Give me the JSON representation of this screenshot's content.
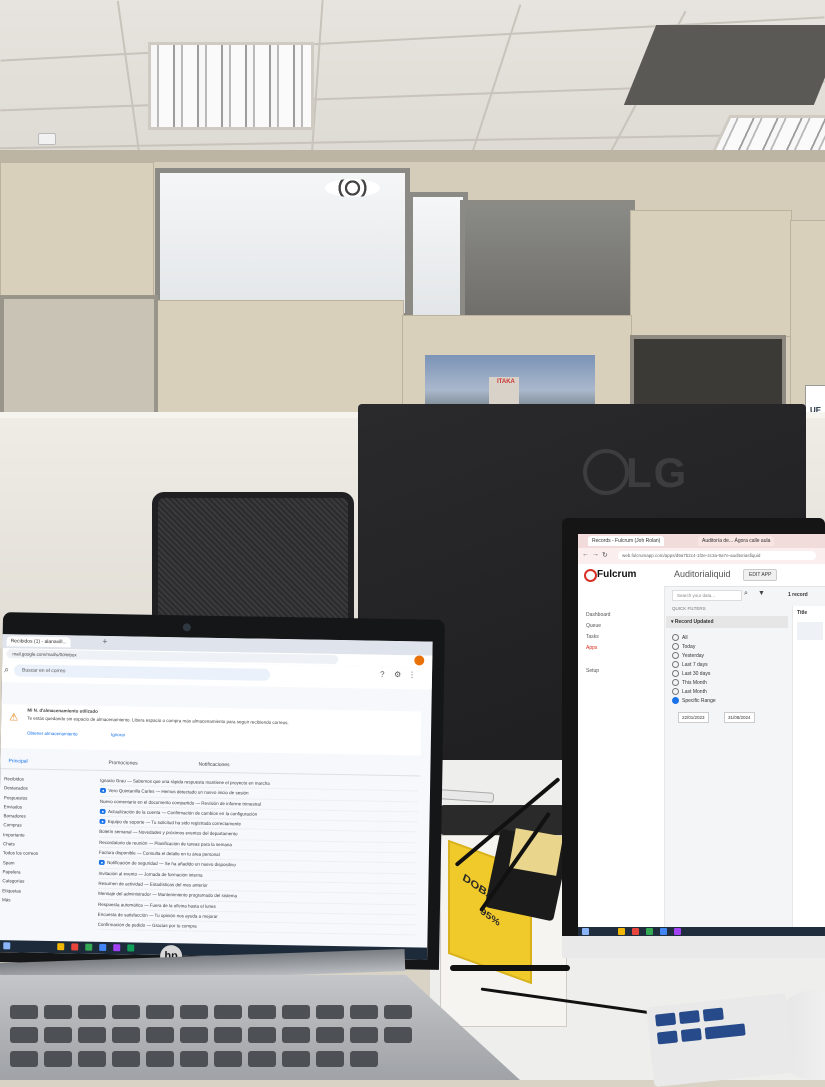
{
  "scene": {
    "monitor_brand": "LG",
    "laptop_brand": "hp",
    "box_label": "DOBAL",
    "box_sub": "95%",
    "poster_text": "ITAKA",
    "cut_off_sign": "UE"
  },
  "laptop": {
    "browser_tab": "Recibidos (1) - alanavill...",
    "url": "mail.google.com/mail/u/0/#inbox",
    "search_placeholder": "Buscar en el correo",
    "warning_title": "Mi N. d'almacenamiento utilizado",
    "warning_body": "Te estás quedando sin espacio de almacenamiento. Libera espacio o compra más almacenamiento para seguir recibiendo correos.",
    "warning_link_1": "Obtener almacenamiento",
    "warning_link_2": "Ignorar",
    "category_tabs": [
      "Principal",
      "Promociones",
      "Notificaciones"
    ],
    "sidebar": [
      "Recibidos",
      "Destacados",
      "Pospuestos",
      "Enviados",
      "Borradores",
      "Compras",
      "Importante",
      "Chats",
      "Todos los correos",
      "Spam",
      "Papelera",
      "Categorías",
      "Etiquetas",
      "Más"
    ],
    "emails": [
      "Ignacio Grau — Sabemos que una rápida respuesta mantiene el proyecto en marcha",
      "Vero Quintanilla Carles — Hemos detectado un nuevo inicio de sesión",
      "Nuevo comentario en el documento compartido — Revisión de informe trimestral",
      "Actualización de la cuenta — Confirmación de cambios en la configuración",
      "Equipo de soporte — Tu solicitud ha sido registrada correctamente",
      "Boletín semanal — Novedades y próximos eventos del departamento",
      "Recordatorio de reunión — Planificación de tareas para la semana",
      "Factura disponible — Consulta el detalle en tu área personal",
      "Notificación de seguridad — Se ha añadido un nuevo dispositivo",
      "Invitación al evento — Jornada de formación interna",
      "Resumen de actividad — Estadísticas del mes anterior",
      "Mensaje del administrador — Mantenimiento programado del sistema",
      "Respuesta automática — Fuera de la oficina hasta el lunes",
      "Encuesta de satisfacción — Tu opinión nos ayuda a mejorar",
      "Confirmación de pedido — Gracias por tu compra"
    ]
  },
  "monitor": {
    "browser_tab_1": "Records - Fulcrum (Joh Rolan)",
    "browser_tab_2": "Auditoría de... Ágora calle aula",
    "url": "web.fulcrumapp.com/apps/d9a7b2c4-1f2e-4c3a-9a7e-auditoriasfiquid",
    "brand": "Fulcrum",
    "app_name": "Auditorialiquid",
    "edit_button": "EDIT APP",
    "search_placeholder": "Search your data...",
    "record_count": "1 record",
    "sidebar": [
      "Dashboard",
      "Queue",
      "Tasks",
      "Apps"
    ],
    "sidebar_secondary": "Setup",
    "quick_filters": "QUICK FILTERS",
    "filter_header": "Record Updated",
    "filter_options": [
      "All",
      "Today",
      "Yesterday",
      "Last 7 days",
      "Last 30 days",
      "This Month",
      "Last Month",
      "Specific Range"
    ],
    "selected_option": "Specific Range",
    "date_from": "22/01/2023",
    "date_to": "31/08/2024",
    "column_title": "Title"
  }
}
